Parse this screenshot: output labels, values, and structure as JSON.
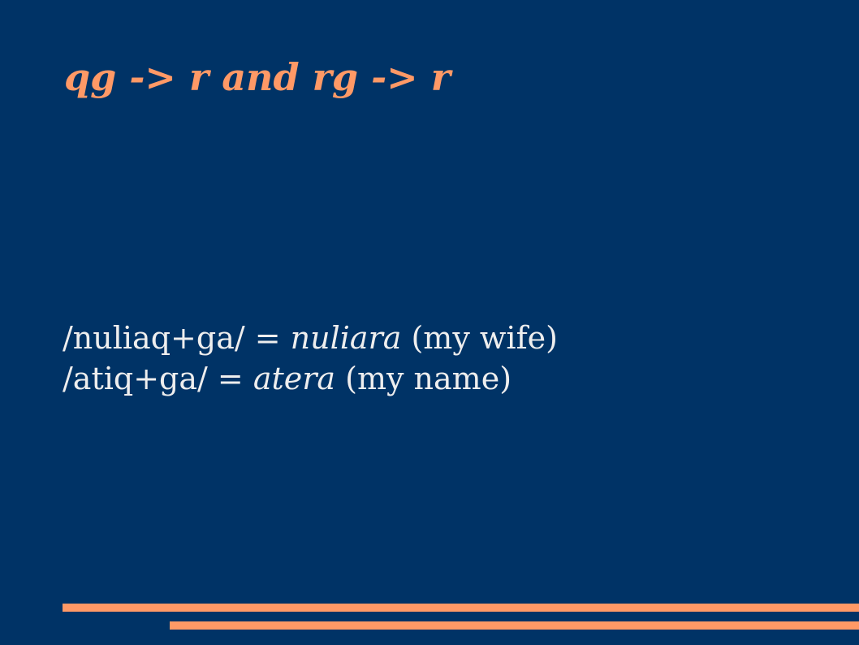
{
  "slide": {
    "title": "qg -> r and rg -> r",
    "lines": [
      {
        "form": "/nuliaq+ga/ = ",
        "result": "nuliara",
        "gloss": " (my wife)"
      },
      {
        "form": "/atiq+ga/ = ",
        "result": "atera",
        "gloss": " (my name)"
      }
    ]
  },
  "colors": {
    "background": "#003366",
    "title": "#ff9966",
    "text": "#eeeeee",
    "rule": "#ff9966"
  }
}
